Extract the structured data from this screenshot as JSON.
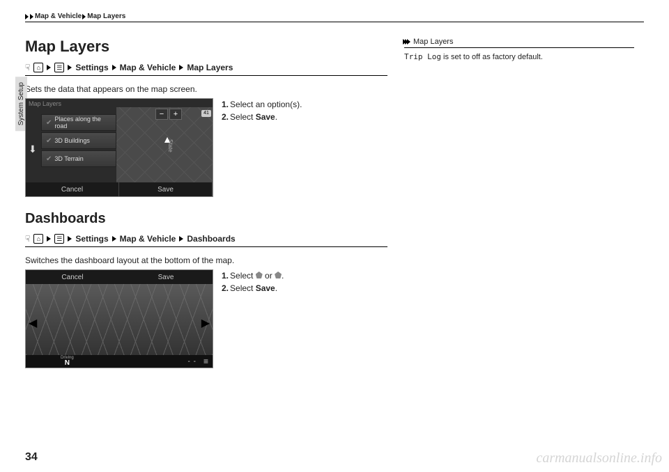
{
  "header": {
    "crumb1": "Map & Vehicle",
    "crumb2": "Map Layers"
  },
  "sideTab": "System Setup",
  "section1": {
    "title": "Map Layers",
    "nav": {
      "settings": "Settings",
      "group": "Map & Vehicle",
      "page": "Map Layers"
    },
    "desc": "Sets the data that appears on the map screen.",
    "steps": {
      "s1": "Select an option(s).",
      "s2pre": "Select ",
      "s2sel": "Save",
      "s2post": "."
    },
    "shot": {
      "title": "Map Layers",
      "item1": "Places along the road",
      "item2": "3D Buildings",
      "item3": "3D Terrain",
      "zoomOut": "−",
      "zoomIn": "+",
      "rec": "41",
      "street": "State",
      "cancel": "Cancel",
      "save": "Save"
    }
  },
  "section2": {
    "title": "Dashboards",
    "nav": {
      "settings": "Settings",
      "group": "Map & Vehicle",
      "page": "Dashboards"
    },
    "desc": "Switches the dashboard layout at the bottom of the map.",
    "steps": {
      "s1pre": "Select ",
      "s1mid": " or ",
      "s1post": ".",
      "s2pre": "Select ",
      "s2sel": "Save",
      "s2post": "."
    },
    "shot": {
      "cancel": "Cancel",
      "save": "Save",
      "drivingLabel": "Driving",
      "direction": "N",
      "dashes": "- -",
      "menu": "≡"
    }
  },
  "tip": {
    "head": "Map Layers",
    "body1": "Trip Log",
    "body2": " is set to off as factory default."
  },
  "pageNumber": "34",
  "watermark": "carmanualsonline.info"
}
